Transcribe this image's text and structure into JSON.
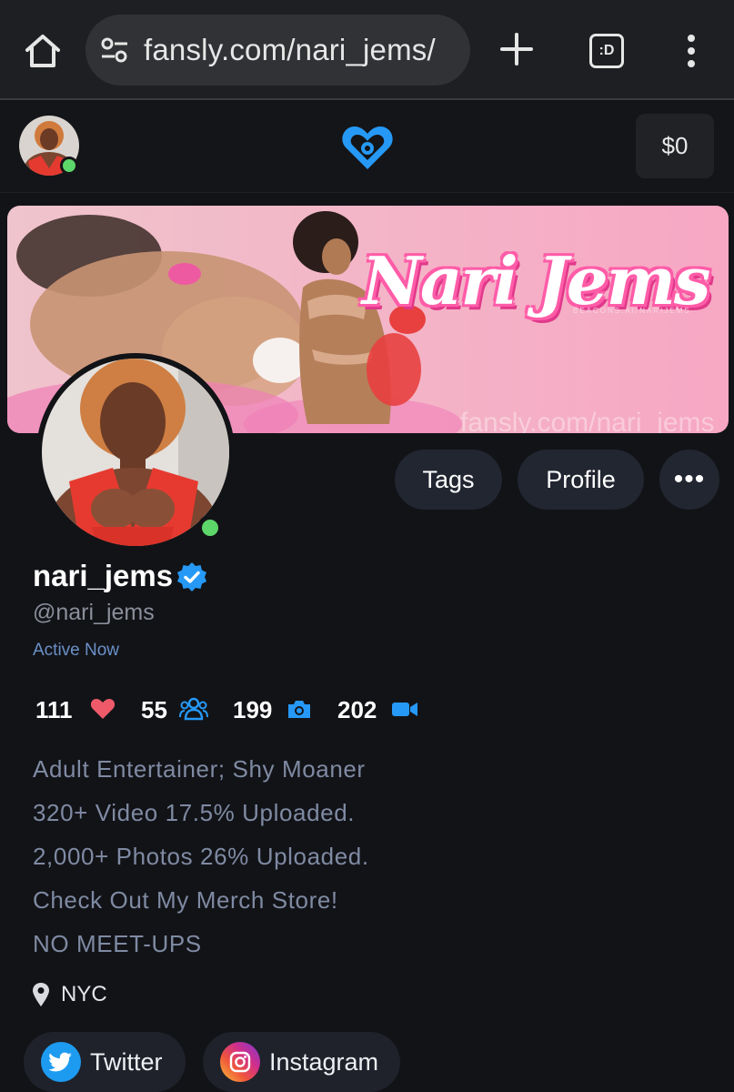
{
  "browser": {
    "url": "fansly.com/nari_jems/",
    "tabs_label": ":D"
  },
  "header": {
    "balance": "$0",
    "logo_icon": "fansly-heart-logo-icon",
    "accent": "#2699f7"
  },
  "banner": {
    "title": "Nari Jems",
    "subtitle": "BEACONS.AI/NARIJEMS",
    "watermark": "fansly.com/nari_jems"
  },
  "actions": {
    "tags": "Tags",
    "profile": "Profile",
    "more": "•••"
  },
  "profile": {
    "display_name": "nari_jems",
    "handle": "@nari_jems",
    "status": "Active Now",
    "online_color": "#5dd66a"
  },
  "stats": {
    "likes": "111",
    "followers": "55",
    "photos": "199",
    "videos": "202"
  },
  "bio": [
    "Adult Entertainer; Shy Moaner",
    "320+ Video 17.5% Uploaded.",
    "2,000+ Photos 26% Uploaded.",
    "Check Out My Merch Store!",
    "NO MEET-UPS"
  ],
  "location": "NYC",
  "social": {
    "twitter": "Twitter",
    "instagram": "Instagram"
  }
}
